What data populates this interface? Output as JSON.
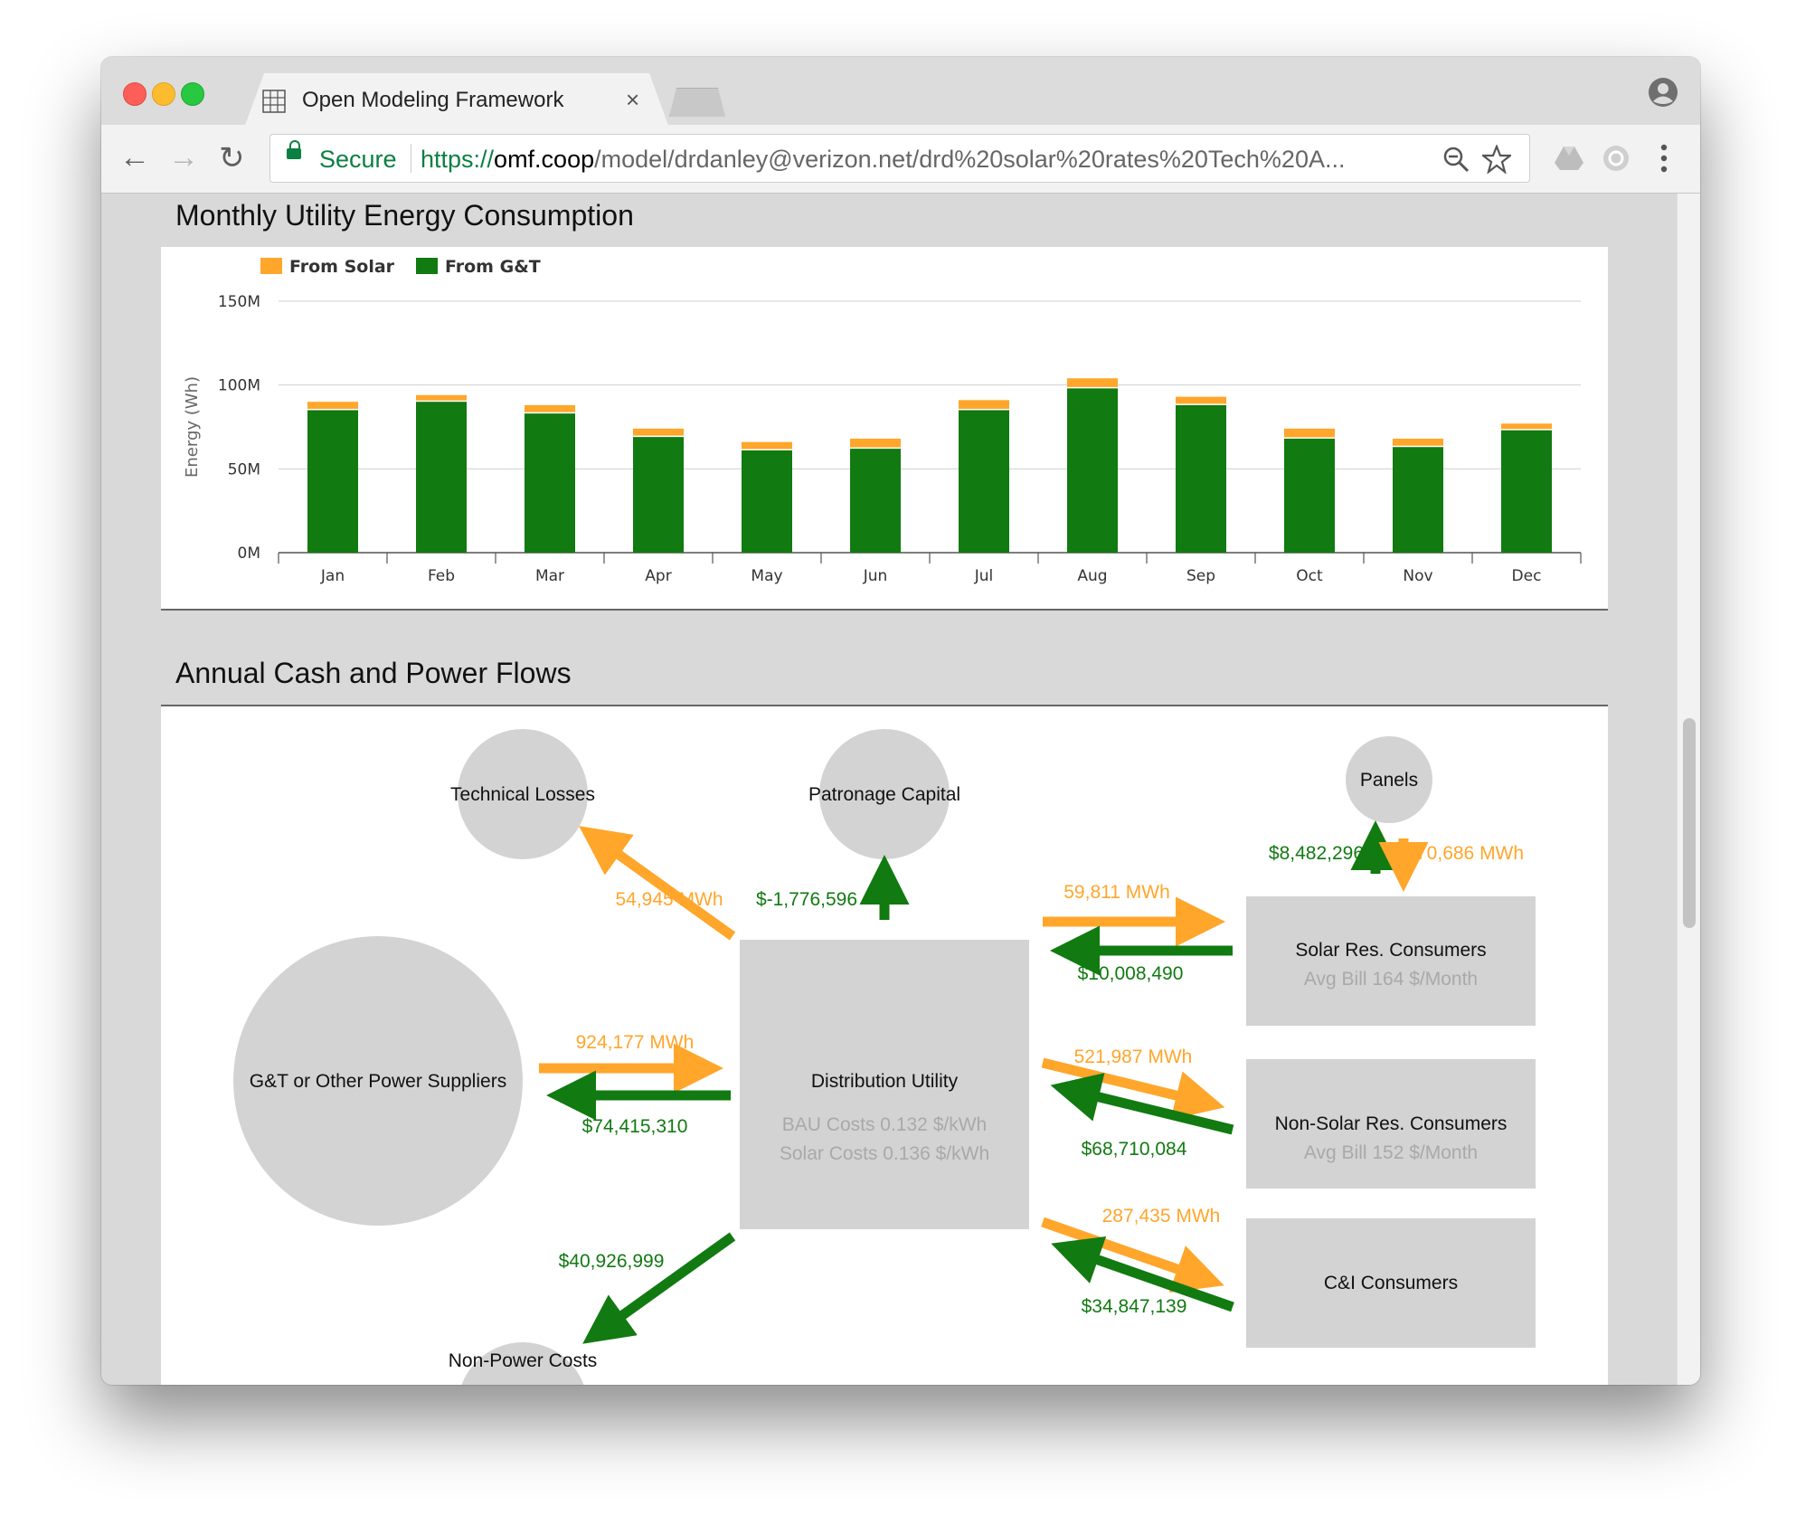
{
  "browser": {
    "tab_title": "Open Modeling Framework",
    "tab_close": "×",
    "security_label": "Secure",
    "url_protocol": "https://",
    "url_host": "omf.coop",
    "url_path": "/model/drdanley@verizon.net/drd%20solar%20rates%20Tech%20A..."
  },
  "chart_section": {
    "title": "Monthly Utility Energy Consumption"
  },
  "chart_data": {
    "type": "bar",
    "stacked": true,
    "categories": [
      "Jan",
      "Feb",
      "Mar",
      "Apr",
      "May",
      "Jun",
      "Jul",
      "Aug",
      "Sep",
      "Oct",
      "Nov",
      "Dec"
    ],
    "series": [
      {
        "name": "From G&T",
        "color": "#117a11",
        "values": [
          85,
          90,
          83,
          69,
          61,
          62,
          85,
          98,
          88,
          68,
          63,
          73
        ]
      },
      {
        "name": "From Solar",
        "color": "#ffa62b",
        "values": [
          5,
          4,
          5,
          5,
          5,
          6,
          6,
          6,
          5,
          6,
          5,
          4
        ]
      }
    ],
    "ylabel": "Energy (Wh)",
    "yticks": [
      "0M",
      "50M",
      "100M",
      "150M"
    ],
    "ylim": [
      0,
      150
    ],
    "grid": true,
    "legend_position": "top-left"
  },
  "flows_section": {
    "title": "Annual Cash and Power Flows",
    "nodes": {
      "technical_losses": "Technical Losses",
      "patronage_capital": "Patronage Capital",
      "panels": "Panels",
      "gt_suppliers": "G&T or Other Power Suppliers",
      "distribution_utility": "Distribution Utility",
      "bau_costs": "BAU Costs 0.132 $/kWh",
      "solar_costs": "Solar Costs 0.136 $/kWh",
      "solar_res": "Solar Res. Consumers",
      "solar_res_bill": "Avg Bill 164 $/Month",
      "nonsolar_res": "Non-Solar Res. Consumers",
      "nonsolar_res_bill": "Avg Bill 152 $/Month",
      "ci": "C&I Consumers",
      "non_power_costs": "Non-Power Costs"
    },
    "flows": {
      "losses_mwh": "54,945 MWh",
      "patronage_cash": "$-1,776,596",
      "panels_cash": "$8,482,296",
      "panels_mwh": "70,686 MWh",
      "gt_mwh": "924,177 MWh",
      "gt_cash": "$74,415,310",
      "solar_res_mwh": "59,811 MWh",
      "solar_res_cash": "$10,008,490",
      "nonsolar_mwh": "521,987 MWh",
      "nonsolar_cash": "$68,710,084",
      "ci_mwh": "287,435 MWh",
      "ci_cash": "$34,847,139",
      "nonpower_cash": "$40,926,999"
    },
    "colors": {
      "power": "#ffa62b",
      "cash": "#117a11",
      "node": "#d3d3d3"
    }
  }
}
